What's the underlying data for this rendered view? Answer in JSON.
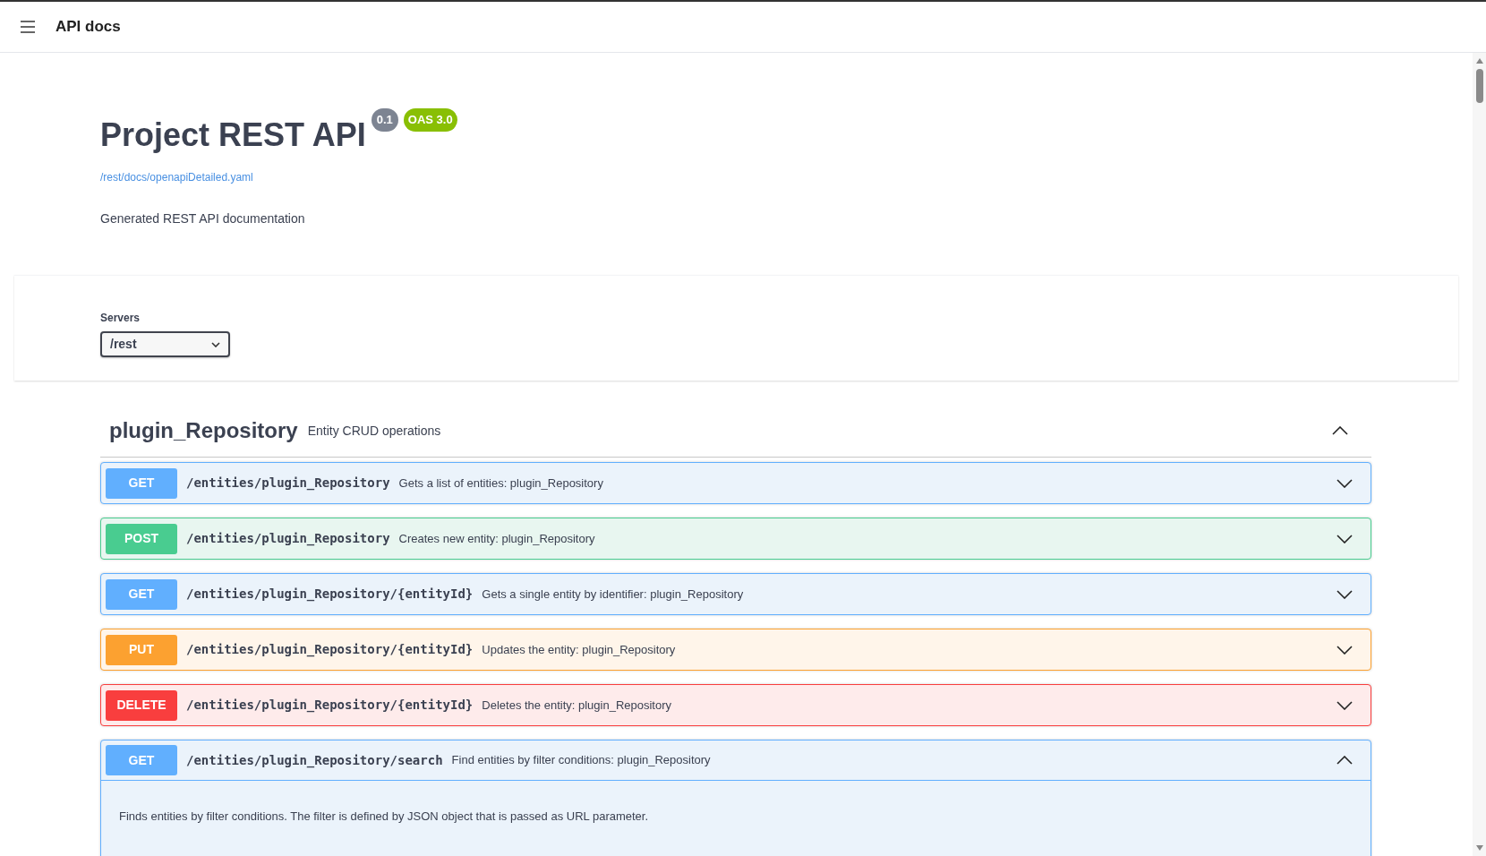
{
  "header": {
    "title": "API docs"
  },
  "info": {
    "title": "Project REST API",
    "version": "0.1",
    "oas": "OAS 3.0",
    "spec_link": "/rest/docs/openapiDetailed.yaml",
    "description": "Generated REST API documentation"
  },
  "servers": {
    "label": "Servers",
    "value": "/rest"
  },
  "tag": {
    "name": "plugin_Repository",
    "description": "Entity CRUD operations",
    "expanded": true,
    "operations": [
      {
        "method": "GET",
        "path": "/entities/plugin_Repository",
        "summary": "Gets a list of entities: plugin_Repository",
        "expanded": false
      },
      {
        "method": "POST",
        "path": "/entities/plugin_Repository",
        "summary": "Creates new entity: plugin_Repository",
        "expanded": false
      },
      {
        "method": "GET",
        "path": "/entities/plugin_Repository/{entityId}",
        "summary": "Gets a single entity by identifier: plugin_Repository",
        "expanded": false
      },
      {
        "method": "PUT",
        "path": "/entities/plugin_Repository/{entityId}",
        "summary": "Updates the entity: plugin_Repository",
        "expanded": false
      },
      {
        "method": "DELETE",
        "path": "/entities/plugin_Repository/{entityId}",
        "summary": "Deletes the entity: plugin_Repository",
        "expanded": false
      },
      {
        "method": "GET",
        "path": "/entities/plugin_Repository/search",
        "summary": "Find entities by filter conditions: plugin_Repository",
        "expanded": true,
        "details": "Finds entities by filter conditions. The filter is defined by JSON object that is passed as URL parameter."
      }
    ]
  }
}
